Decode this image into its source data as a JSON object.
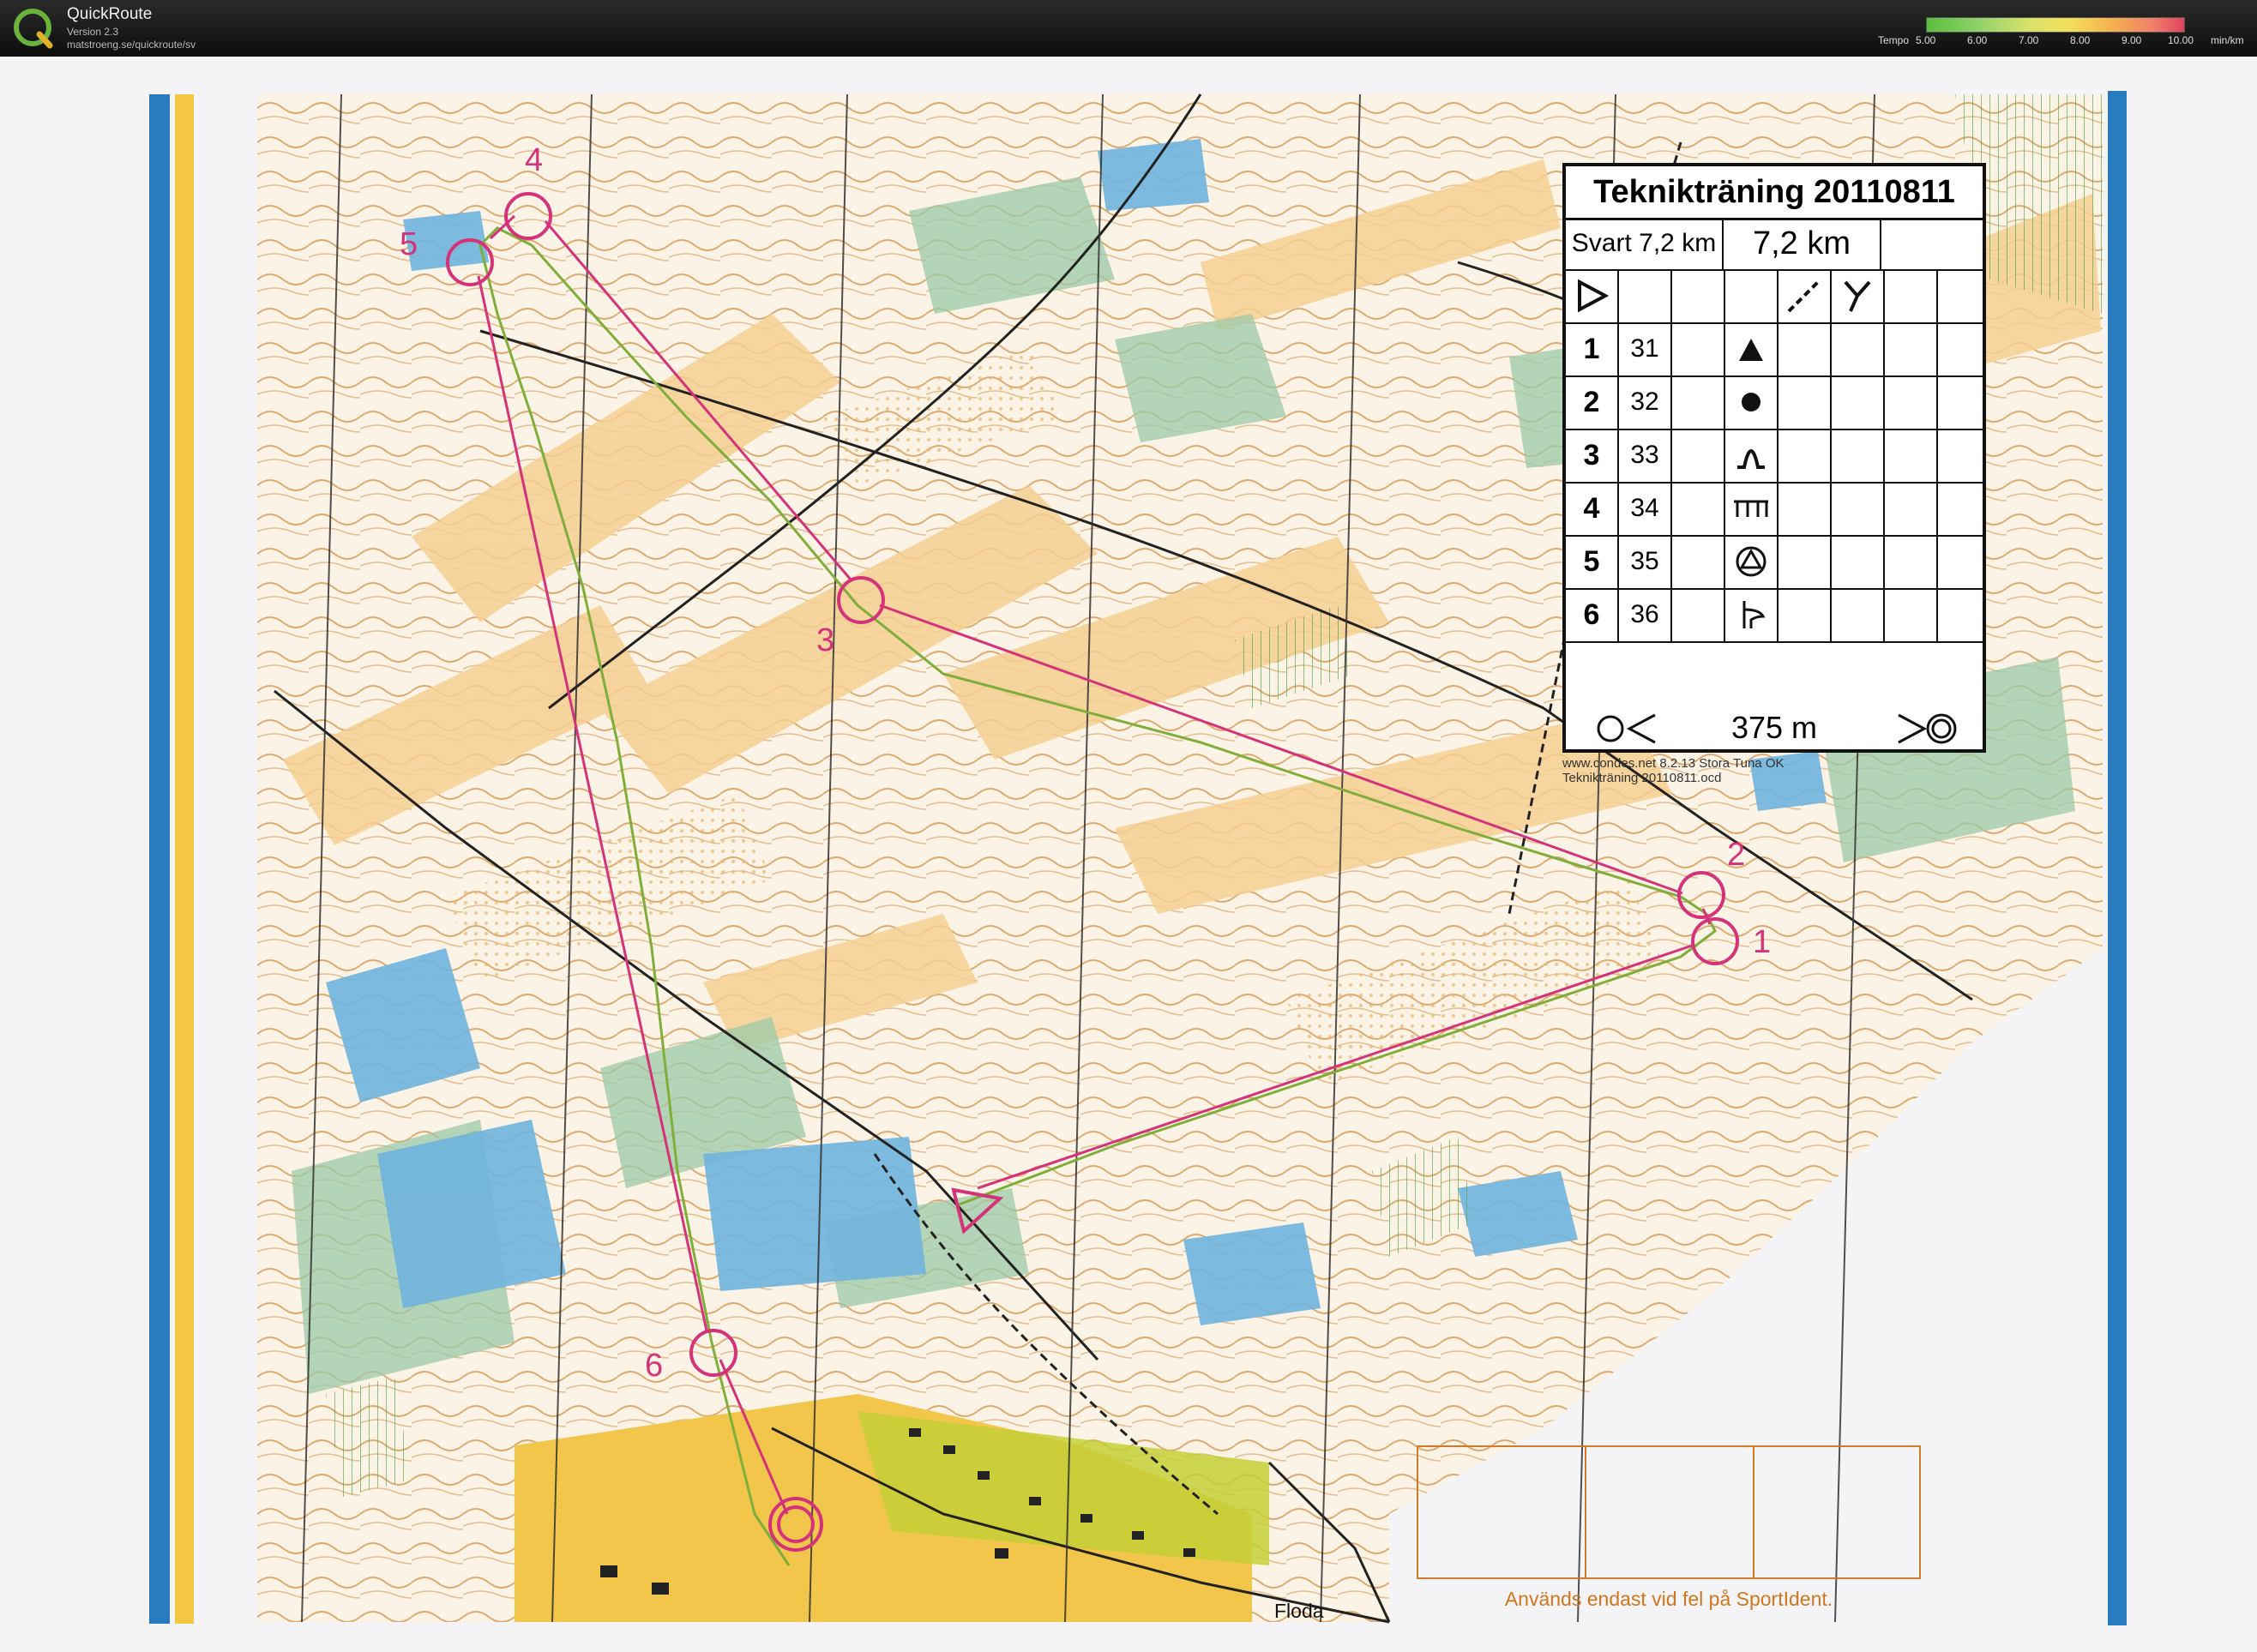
{
  "app": {
    "title": "QuickRoute",
    "version": "Version 2.3",
    "url": "matstroeng.se/quickroute/sv"
  },
  "tempo_legend": {
    "label": "Tempo",
    "ticks": [
      "5.00",
      "6.00",
      "7.00",
      "8.00",
      "9.00",
      "10.00"
    ],
    "unit": "min/km",
    "colors": [
      "#5bbf3c",
      "#d9e36a",
      "#f4b14e",
      "#e2445e"
    ]
  },
  "control_description": {
    "title": "Teknikträning 20110811",
    "class": "Svart 7,2 km",
    "length": "7,2 km",
    "controls": [
      {
        "number": "1",
        "code": "31",
        "feature": "triangle-boulder-icon"
      },
      {
        "number": "2",
        "code": "32",
        "feature": "dot-knoll-icon"
      },
      {
        "number": "3",
        "code": "33",
        "feature": "hill-spur-icon"
      },
      {
        "number": "4",
        "code": "34",
        "feature": "fence-comb-icon"
      },
      {
        "number": "5",
        "code": "35",
        "feature": "circle-triangle-icon"
      },
      {
        "number": "6",
        "code": "36",
        "feature": "trail-junction-icon"
      }
    ],
    "finish_distance": "375 m"
  },
  "map_note": {
    "line1": "www.condes.net 8.2.13 Stora Tuna OK",
    "line2": "Teknikträning 20110811.ocd"
  },
  "map": {
    "control_labels": [
      "1",
      "2",
      "3",
      "4",
      "5",
      "6"
    ],
    "place_name": "Floda",
    "punch_note": "Används endast vid fel på SportIdent.",
    "course_color": "#d4337a",
    "route_color": "#7fae3a"
  }
}
